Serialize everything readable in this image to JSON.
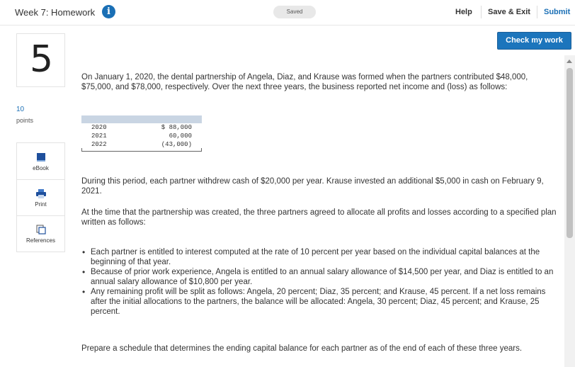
{
  "header": {
    "title": "Week 7: Homework",
    "info_icon": "i",
    "saved": "Saved",
    "help": "Help",
    "save_exit": "Save & Exit",
    "submit": "Submit"
  },
  "check_button": "Check my work",
  "question": {
    "number": "5",
    "points_value": "10",
    "points_label": "points"
  },
  "tools": [
    {
      "label": "eBook",
      "icon": "book-icon"
    },
    {
      "label": "Print",
      "icon": "print-icon"
    },
    {
      "label": "References",
      "icon": "references-icon"
    }
  ],
  "body": {
    "intro": "On January 1, 2020, the dental partnership of Angela, Diaz, and Krause was formed when the partners contributed $48,000, $75,000, and $78,000, respectively. Over the next three years, the business reported net income and (loss) as follows:",
    "table": [
      {
        "year": "2020",
        "amount": "$ 88,000"
      },
      {
        "year": "2021",
        "amount": "60,000"
      },
      {
        "year": "2022",
        "amount": "(43,000)"
      }
    ],
    "withdraw": "During this period, each partner withdrew cash of $20,000 per year. Krause invested an additional $5,000 in cash on February 9, 2021.",
    "agreement": "At the time that the partnership was created, the three partners agreed to allocate all profits and losses according to a specified plan written as follows:",
    "bullets": [
      "Each partner is entitled to interest computed at the rate of 10 percent per year based on the individual capital balances at the beginning of that year.",
      "Because of prior work experience, Angela is entitled to an annual salary allowance of $14,500 per year, and Diaz is entitled to an annual salary allowance of $10,800 per year.",
      "Any remaining profit will be split as follows: Angela, 20 percent; Diaz, 35 percent; and Krause, 45 percent. If a net loss remains after the initial allocations to the partners, the balance will be allocated: Angela, 30 percent; Diaz, 45 percent; and Krause, 25 percent."
    ],
    "prompt": "Prepare a schedule that determines the ending capital balance for each partner as of the end of each of these three years."
  }
}
